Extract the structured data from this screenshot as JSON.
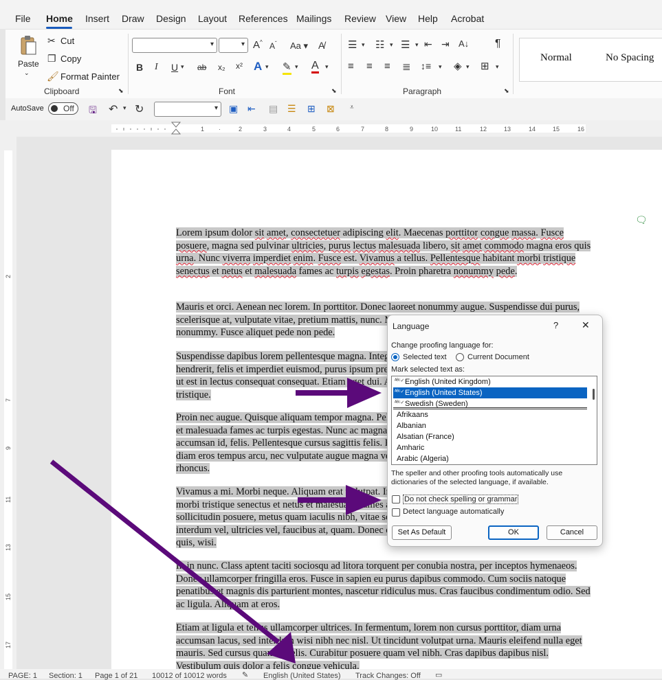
{
  "menu": {
    "tabs": [
      "File",
      "Home",
      "Insert",
      "Draw",
      "Design",
      "Layout",
      "References",
      "Mailings",
      "Review",
      "View",
      "Help",
      "Acrobat"
    ],
    "active": "Home"
  },
  "clipboard": {
    "paste": "Paste",
    "cut": "Cut",
    "copy": "Copy",
    "format_painter": "Format Painter",
    "label": "Clipboard"
  },
  "font": {
    "label": "Font",
    "bold": "B",
    "italic": "I",
    "underline": "U",
    "strike": "ab",
    "subscript": "x₂",
    "superscript": "x²"
  },
  "paragraph": {
    "label": "Paragraph",
    "pilcrow": "¶"
  },
  "styles": {
    "normal": "Normal",
    "no_spacing": "No Spacing"
  },
  "autosave": {
    "label": "AutoSave",
    "state": "Off"
  },
  "document": {
    "p1": [
      "Lorem ipsum dolor ",
      "sit",
      " ",
      "amet",
      ", ",
      "consectetuer",
      " adipiscing ",
      "elit",
      ". Maecenas ",
      "porttitor",
      " ",
      "congue",
      " ",
      "massa",
      ". ",
      "Fusce",
      " ",
      "posuere",
      ", magna sed pulvinar ",
      "ultricies",
      ", ",
      "purus",
      " ",
      "lectus",
      " ",
      "malesuada",
      " libero, ",
      "sit",
      " ",
      "amet",
      " ",
      "commodo",
      " magna eros quis ",
      "urna",
      ". Nunc ",
      "viverra",
      " ",
      "imperdiet",
      " ",
      "enim",
      ". ",
      "Fusce",
      " est. ",
      "Vivamus",
      " a tellus. ",
      "Pellentesque",
      " habitant ",
      "morbi",
      " ",
      "tristique",
      " ",
      "senectus",
      " et ",
      "netus",
      " et ",
      "malesuada",
      " fames ac ",
      "turpis",
      " ",
      "egestas",
      ". Proin pharetra ",
      "nonummy",
      " ",
      "pede",
      "."
    ],
    "p2": "Mauris et orci. Aenean nec lorem. In porttitor. Donec laoreet nonummy augue. Suspendisse dui purus, scelerisque at, vulputate vitae, pretium mattis, nunc. Mauris eget neque at sem venenatis eleifend. Ut nonummy. Fusce aliquet pede non pede.",
    "p3": "Suspendisse dapibus lorem pellentesque magna. Integer nulla. Donec blandit feugiat ligula. Donec hendrerit, felis et imperdiet euismod, purus ipsum pretium metus, in lacinia nulla nisl eget sapien. Donec ut est in lectus consequat consequat. Etiam eget dui. Aliquam erat volutpat. Sed at lorem in nunc porta tristique.",
    "p4": "Proin nec augue. Quisque aliquam tempor magna. Pellentesque habitant morbi tristique senectus et netus et malesuada fames ac turpis egestas. Nunc ac magna. Maecenas odio dolor, vulputate vel, auctor ac, accumsan id, felis. Pellentesque cursus sagittis felis. Pellentesque porttitor, velit lacinia egestas auctor, diam eros tempus arcu, nec vulputate augue magna vel risus. Cras non magna vel ante adipiscing rhoncus.",
    "p5": "Vivamus a mi. Morbi neque. Aliquam erat volutpat. Integer ultrices lobortis eros. Pellentesque habitant morbi tristique senectus et netus et malesuada fames ac turpis egestas. Proin semper, ante vitae sollicitudin posuere, metus quam iaculis nibh, vitae scelerisque nunc massa eget pede. Sed velit urna, interdum vel, ultricies vel, faucibus at, quam. Donec elit est, consectetuer eget, consequat quis, tempus quis, wisi.",
    "p6": "In in nunc. Class aptent taciti sociosqu ad litora torquent per conubia nostra, per inceptos hymenaeos. Donec ullamcorper fringilla eros. Fusce in sapien eu purus dapibus commodo. Cum sociis natoque penatibus et magnis dis parturient montes, nascetur ridiculus mus. Cras faucibus condimentum odio. Sed ac ligula. Aliquam at eros.",
    "p7": "Etiam at ligula et tellus ullamcorper ultrices. In fermentum, lorem non cursus porttitor, diam urna accumsan lacus, sed interdum wisi nibh nec nisl. Ut tincidunt volutpat urna. Mauris eleifend nulla eget mauris. Sed cursus quam id felis. Curabitur posuere quam vel nibh. Cras dapibus dapibus nisl. Vestibulum quis dolor a felis congue vehicula."
  },
  "dialog": {
    "title": "Language",
    "help": "?",
    "close": "✕",
    "change_for": "Change proofing language for:",
    "opt_selected": "Selected text",
    "opt_document": "Current Document",
    "mark_as": "Mark selected text as:",
    "languages": [
      "English (United Kingdom)",
      "English (United States)",
      "Swedish (Sweden)",
      "Afrikaans",
      "Albanian",
      "Alsatian (France)",
      "Amharic",
      "Arabic (Algeria)"
    ],
    "selected_language": "English (United States)",
    "info": "The speller and other proofing tools automatically use dictionaries of the selected language, if available.",
    "no_check": "Do not check spelling or grammar",
    "detect": "Detect language automatically",
    "set_default": "Set As Default",
    "ok": "OK",
    "cancel": "Cancel"
  },
  "status": {
    "page": "PAGE: 1",
    "section": "Section: 1",
    "page_of": "Page 1 of 21",
    "words": "10012 of 10012 words",
    "language": "English (United States)",
    "track": "Track Changes: Off"
  },
  "colors": {
    "accent": "#185abd",
    "arrow": "#5b0a7a",
    "highlight": "#c8c8c8",
    "selection": "#0a64c2"
  }
}
